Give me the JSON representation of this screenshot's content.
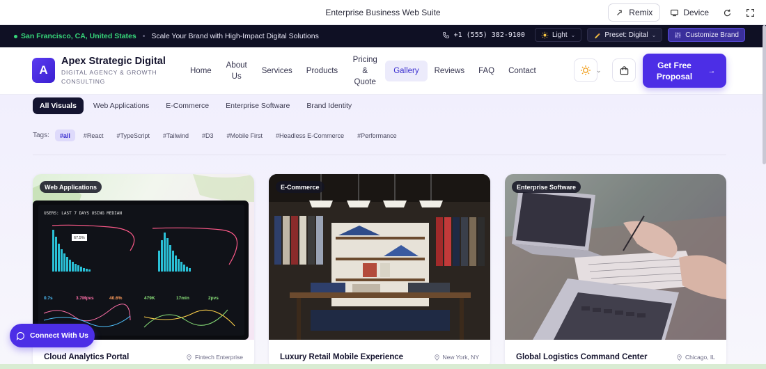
{
  "window": {
    "title": "Enterprise Business Web Suite",
    "remix_label": "Remix",
    "device_label": "Device"
  },
  "strip": {
    "location": "San Francisco, CA, United States",
    "message": "Scale Your Brand with High-Impact Digital Solutions",
    "phone": "+1 (555) 382-9100",
    "theme_label": "Light",
    "preset_label": "Preset: Digital",
    "customize_label": "Customize Brand"
  },
  "brand": {
    "initial": "A",
    "name": "Apex Strategic Digital",
    "tagline": "DIGITAL AGENCY & GROWTH CONSULTING"
  },
  "nav": {
    "items": [
      {
        "label": "Home"
      },
      {
        "label": "About Us"
      },
      {
        "label": "Services"
      },
      {
        "label": "Products"
      },
      {
        "label": "Pricing & Quote"
      },
      {
        "label": "Gallery",
        "active": true
      },
      {
        "label": "Reviews"
      },
      {
        "label": "FAQ"
      },
      {
        "label": "Contact"
      }
    ],
    "cta_label": "Get Free Proposal"
  },
  "filters": [
    "All Visuals",
    "Web Applications",
    "E-Commerce",
    "Enterprise Software",
    "Brand Identity"
  ],
  "tags": {
    "label": "Tags:",
    "items": [
      "#all",
      "#React",
      "#TypeScript",
      "#Tailwind",
      "#D3",
      "#Mobile First",
      "#Headless E-Commerce",
      "#Performance"
    ]
  },
  "cards": [
    {
      "badge": "Web Applications",
      "title": "Cloud Analytics Portal",
      "location": "Fintech Enterprise"
    },
    {
      "badge": "E-Commerce",
      "title": "Luxury Retail Mobile Experience",
      "location": "New York, NY"
    },
    {
      "badge": "Enterprise Software",
      "title": "Global Logistics Command Center",
      "location": "Chicago, IL"
    }
  ],
  "dashboard_art": {
    "header": "USERS: LAST 7 DAYS USING MEDIAN",
    "metrics": [
      "0.7s",
      "3.7Mpvs",
      "40.6%",
      "479K",
      "17min",
      "2pvs"
    ],
    "callout": "67.5%"
  },
  "chat_label": "Connect With Us",
  "colors": {
    "accent": "#4c2ee6",
    "strip_bg": "#0f1024",
    "location_green": "#37d67a"
  }
}
